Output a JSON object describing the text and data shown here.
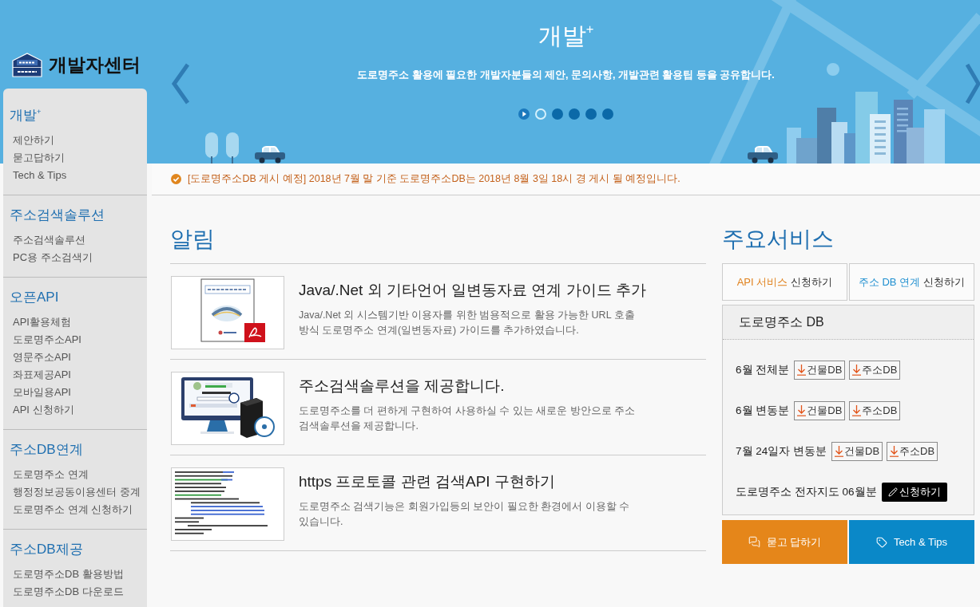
{
  "logo": {
    "title": "개발자센터"
  },
  "sidebar": {
    "sections": [
      {
        "heading": "개발$^{+}$",
        "items": [
          "제안하기",
          "묻고답하기",
          "Tech & Tips"
        ]
      },
      {
        "heading": "주소검색솔루션",
        "items": [
          "주소검색솔루션",
          "PC용 주소검색기"
        ]
      },
      {
        "heading": "오픈API",
        "items": [
          "API활용체험",
          "도로명주소API",
          "영문주소API",
          "좌표제공API",
          "모바일용API",
          "API 신청하기"
        ]
      },
      {
        "heading": "주소DB연계",
        "items": [
          "도로명주소 연계",
          "행정정보공동이용센터 중계",
          "도로명주소 연계 신청하기"
        ]
      },
      {
        "heading": "주소DB제공",
        "items": [
          "도로명주소DB 활용방법",
          "도로명주소DB 다운로드"
        ]
      }
    ]
  },
  "banner": {
    "title": "개발$^{+}$",
    "subtitle": "도로명주소 활용에 필요한 개발자분들의 제안, 문의사항, 개발관련 활용팁 등을 공유합니다.",
    "slides": [
      {
        "selected": true
      },
      {
        "selected": false
      },
      {
        "selected": false
      },
      {
        "selected": false
      },
      {
        "selected": false
      }
    ]
  },
  "notice": {
    "text": "[도로명주소DB 게시 예정] 2018년 7월 말 기준 도로명주소DB는 2018년 8월 3일 18시 경 게시 될 예정입니다."
  },
  "news": {
    "heading": "알림",
    "items": [
      {
        "kind": "document",
        "title": "Java/.Net 외 기타언어 일변동자료 연계 가이드 추가",
        "description": "Java/.Net 외 시스템기반 이용자를 위한 범용적으로 활용 가능한 URL 호출방식 도로명주소 연계(일변동자료) 가이드를 추가하였습니다."
      },
      {
        "kind": "monitor",
        "title": "주소검색솔루션을 제공합니다.",
        "description": "도로명주소를 더 편하게 구현하여 사용하실 수 있는 새로운 방안으로 주소검색솔루션을 제공합니다."
      },
      {
        "kind": "code",
        "title": "https 프로토콜 관련 검색API 구현하기",
        "description": "도로명주소 검색기능은 회원가입등의 보안이 필요한 환경에서 이용할 수 있습니다."
      }
    ]
  },
  "services": {
    "heading": "주요서비스",
    "links": [
      {
        "highlight": "API 서비스",
        "text": "신청하기",
        "color": "#e0821e"
      },
      {
        "highlight": "주소 DB 연계",
        "text": "신청하기",
        "color": "#1f8fd0"
      }
    ],
    "db_panel": {
      "title": "도로명주소 DB",
      "rows": [
        {
          "kind": "download",
          "label": "6월 전체분",
          "buttons": [
            "건물DB",
            "주소DB"
          ]
        },
        {
          "kind": "download",
          "label": "6월 변동분",
          "buttons": [
            "건물DB",
            "주소DB"
          ]
        },
        {
          "kind": "download",
          "label": "7월 24일자 변동분",
          "buttons": [
            "건물DB",
            "주소DB"
          ]
        },
        {
          "kind": "apply",
          "label": "도로명주소 전자지도 06월분",
          "buttons": [
            "신청하기"
          ]
        }
      ]
    },
    "quick_links": [
      {
        "kind": "qna",
        "label": "묻고 답하기"
      },
      {
        "kind": "tips",
        "label": "Tech & Tips"
      }
    ]
  }
}
